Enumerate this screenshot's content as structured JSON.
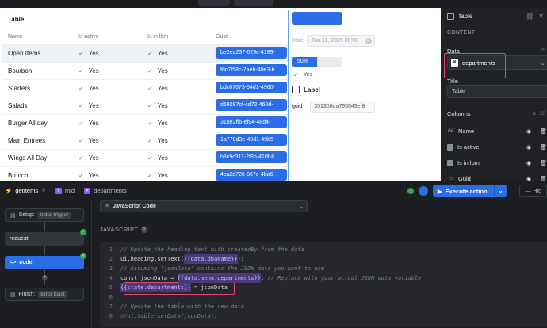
{
  "table_widget": {
    "title": "Table",
    "headers": [
      "Name",
      "Is active",
      "Is in lbm",
      "Guid"
    ],
    "rows": [
      {
        "name": "Open Items",
        "active": "Yes",
        "inlbm": "Yes",
        "guid": "be2ea237-029c-4189-"
      },
      {
        "name": "Bourbon",
        "active": "Yes",
        "inlbm": "Yes",
        "guid": "f8c7f58c-7aeb-40e3-b"
      },
      {
        "name": "Starters",
        "active": "Yes",
        "inlbm": "Yes",
        "guid": "bdc67673-54d1-4960-"
      },
      {
        "name": "Salads",
        "active": "Yes",
        "inlbm": "Yes",
        "guid": "d69287cf-cd72-460d-"
      },
      {
        "name": "Burger All day",
        "active": "Yes",
        "inlbm": "Yes",
        "guid": "318e2ff6-ef94-48d4-"
      },
      {
        "name": "Main Entrees",
        "active": "Yes",
        "inlbm": "Yes",
        "guid": "1a778d3e-49d1-49b5-"
      },
      {
        "name": "Wings All Day",
        "active": "Yes",
        "inlbm": "Yes",
        "guid": "b8c9c311-2f8b-410f-8"
      },
      {
        "name": "Brunch",
        "active": "Yes",
        "inlbm": "Yes",
        "guid": "4ca2d726-867e-4ba6-"
      }
    ]
  },
  "widgets": {
    "date_label": "Date",
    "date_value": "Jun 11, 2025 00:00",
    "progress_text": "50%",
    "progress_fraction": 0.5,
    "yes_text": "Yes",
    "checkbox_label": "Label",
    "guid_label": "guid",
    "guid_value": "351306da795549ef8"
  },
  "right_panel": {
    "component_name": "table",
    "section": "CONTENT",
    "data_label": "Data",
    "js_tag": "JS",
    "data_source": "departments",
    "title_label": "Title",
    "title_value": "Table",
    "columns_label": "Columns",
    "columns": [
      {
        "icon": "Aa",
        "label": "Name"
      },
      {
        "icon": "check",
        "label": "Is active"
      },
      {
        "icon": "check",
        "label": "Is in lbm"
      },
      {
        "icon": "id",
        "label": "Guid"
      }
    ]
  },
  "bottom": {
    "tabs": [
      {
        "label": "getItems",
        "icon": "lightning-icon"
      },
      {
        "label": "mid",
        "icon": "query-icon"
      },
      {
        "label": "departments",
        "icon": "query-icon"
      }
    ],
    "execute_label": "Execute action",
    "hide_label": "Hid",
    "flow": {
      "setup_label": "Setup:",
      "setup_tag": "Initial trigger",
      "request_label": "request",
      "code_label": "code",
      "finish_label": "Finish:",
      "finish_tag": "Error toast"
    },
    "editor": {
      "language": "JavaScript Code",
      "section_label": "JAVASCRIPT",
      "help": "?",
      "lines": [
        {
          "n": "1",
          "parts": [
            {
              "t": "// Update the heading text with createdBy from the data",
              "c": "cm"
            }
          ]
        },
        {
          "n": "2",
          "parts": [
            {
              "t": "ui.heading.setText(",
              "c": "plain"
            },
            {
              "t": "{{data.dbaName}}",
              "c": "ex"
            },
            {
              "t": ");",
              "c": "plain"
            }
          ]
        },
        {
          "n": "3",
          "parts": [
            {
              "t": "// Assuming 'jsonData' contains the JSON data you want to use",
              "c": "cm"
            }
          ]
        },
        {
          "n": "4",
          "parts": [
            {
              "t": "const jsonData = ",
              "c": "plain"
            },
            {
              "t": "{{data.menu.departments}}",
              "c": "ex"
            },
            {
              "t": "; ",
              "c": "plain"
            },
            {
              "t": "// Replace with your actual JSON data variable",
              "c": "cm"
            }
          ]
        },
        {
          "n": "5",
          "parts": [
            {
              "t": "{{state.departments}}",
              "c": "ex"
            },
            {
              "t": " = jsonData",
              "c": "plain"
            }
          ]
        },
        {
          "n": "6",
          "parts": []
        },
        {
          "n": "7",
          "parts": [
            {
              "t": "// Update the table with the new data",
              "c": "cm"
            }
          ]
        },
        {
          "n": "8",
          "parts": [
            {
              "t": "//ui.table.setData(jsonData);",
              "c": "cm"
            }
          ]
        }
      ]
    }
  },
  "colors": {
    "accent": "#2b6de8",
    "highlight": "#e0457b",
    "success": "#2fa84f"
  }
}
